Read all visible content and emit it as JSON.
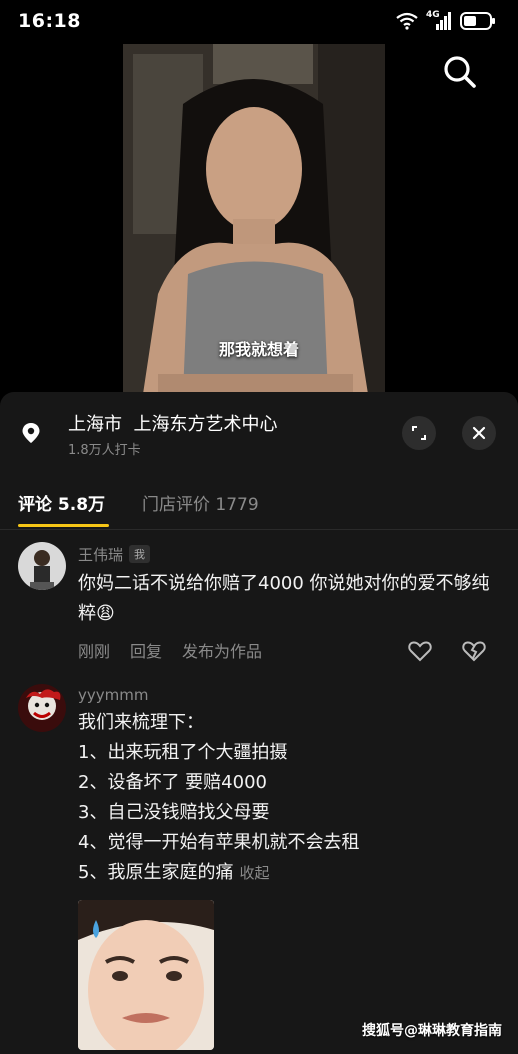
{
  "status_bar": {
    "time": "16:18",
    "network": "4G",
    "icons": [
      "wifi-icon",
      "signal-icon",
      "battery-icon"
    ]
  },
  "video": {
    "caption": "那我就想着",
    "search_icon": "search-icon"
  },
  "location": {
    "title": "上海市  上海东方艺术中心",
    "subtitle": "1.8万人打卡",
    "pin_icon": "location-pin-icon",
    "expand_icon": "expand-icon",
    "close_icon": "close-icon"
  },
  "tabs": {
    "active": "评论 5.8万",
    "inactive": "门店评价 1779",
    "accent": "#f5c516"
  },
  "comments": [
    {
      "user": "王伟瑞",
      "badge": "我",
      "text": "你妈二话不说给你赔了4000 你说她对你的爱不够纯粹😩",
      "time": "刚刚",
      "reply": "回复",
      "post_as_work": "发布为作品"
    },
    {
      "user": "yyymmm",
      "lines": [
        "我们来梳理下：",
        "1、出来玩租了个大疆拍摄",
        "2、设备坏了 要赔4000",
        "3、自己没钱赔找父母要",
        "4、觉得一开始有苹果机就不会去租",
        "5、我原生家庭的痛"
      ],
      "collapse": "收起"
    }
  ],
  "watermark": "搜狐号@琳琳教育指南"
}
